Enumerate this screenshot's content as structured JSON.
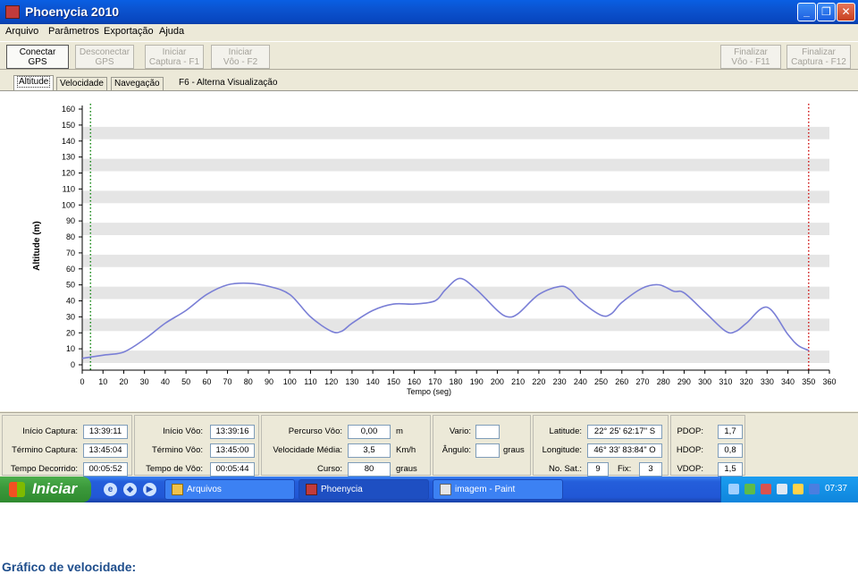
{
  "window": {
    "title": "Phoenycia 2010"
  },
  "menu": [
    "Arquivo",
    "Parâmetros",
    "Exportação",
    "Ajuda"
  ],
  "toolbar": {
    "buttons": [
      {
        "line1": "Conectar",
        "line2": "GPS",
        "enabled": true
      },
      {
        "line1": "Desconectar",
        "line2": "GPS",
        "enabled": false
      },
      {
        "line1": "Iniciar",
        "line2": "Captura - F1",
        "enabled": false
      },
      {
        "line1": "Iniciar",
        "line2": "Vôo - F2",
        "enabled": false
      },
      {
        "line1": "Finalizar",
        "line2": "Vôo - F11",
        "enabled": false
      },
      {
        "line1": "Finalizar",
        "line2": "Captura - F12",
        "enabled": false
      }
    ]
  },
  "tabs": [
    "Altitude",
    "Velocidade",
    "Navegação"
  ],
  "tab_hint": "F6 - Alterna Visualização",
  "chart_data": {
    "type": "line",
    "xlabel": "Tempo (seg)",
    "ylabel": "Altitude (m)",
    "xlim": [
      0,
      360
    ],
    "ylim": [
      0,
      160
    ],
    "xticks": [
      0,
      10,
      20,
      30,
      40,
      50,
      60,
      70,
      80,
      90,
      100,
      110,
      120,
      130,
      140,
      150,
      160,
      170,
      180,
      190,
      200,
      210,
      220,
      230,
      240,
      250,
      260,
      270,
      280,
      290,
      300,
      310,
      320,
      330,
      340,
      350,
      360
    ],
    "yticks": [
      0,
      10,
      20,
      30,
      40,
      50,
      60,
      70,
      80,
      90,
      100,
      110,
      120,
      130,
      140,
      150,
      160
    ],
    "grid": "horizontal bands",
    "markers": [
      {
        "x": 4,
        "color": "#1a8a1a",
        "style": "dotted"
      },
      {
        "x": 350,
        "color": "#d11c1c",
        "style": "dotted"
      }
    ],
    "series": [
      {
        "color": "#7a7fd6",
        "x": [
          0,
          10,
          20,
          30,
          40,
          50,
          60,
          70,
          80,
          90,
          100,
          110,
          120,
          125,
          130,
          140,
          150,
          160,
          170,
          175,
          182,
          190,
          200,
          205,
          210,
          220,
          230,
          235,
          240,
          250,
          255,
          260,
          270,
          278,
          285,
          290,
          300,
          310,
          315,
          320,
          330,
          340,
          345,
          350
        ],
        "y": [
          4,
          6,
          8,
          16,
          26,
          34,
          44,
          50,
          51,
          49,
          44,
          30,
          21,
          21,
          26,
          34,
          38,
          38,
          40,
          47,
          54,
          47,
          34,
          30,
          32,
          44,
          49,
          47,
          40,
          31,
          32,
          39,
          48,
          50,
          46,
          45,
          33,
          21,
          21,
          26,
          36,
          19,
          12,
          9
        ]
      }
    ]
  },
  "status": {
    "captura": [
      {
        "label": "Início Captura:",
        "value": "13:39:11"
      },
      {
        "label": "Término Captura:",
        "value": "13:45:04"
      },
      {
        "label": "Tempo Decorrido:",
        "value": "00:05:52"
      }
    ],
    "voo": [
      {
        "label": "Início Vôo:",
        "value": "13:39:16"
      },
      {
        "label": "Término Vôo:",
        "value": "13:45:00"
      },
      {
        "label": "Tempo de Vôo:",
        "value": "00:05:44"
      }
    ],
    "percurso": [
      {
        "label": "Percurso Vôo:",
        "value": "0,00",
        "unit": "m"
      },
      {
        "label": "Velocidade Média:",
        "value": "3,5",
        "unit": "Km/h"
      },
      {
        "label": "Curso:",
        "value": "80",
        "unit": "graus"
      }
    ],
    "vario": {
      "label": "Vario:",
      "value": ""
    },
    "angulo": {
      "label": "Ângulo:",
      "value": "",
      "unit": "graus"
    },
    "latitude": {
      "label": "Latitude:",
      "value": "22° 25' 62:17\" S"
    },
    "longitude": {
      "label": "Longitude:",
      "value": "46° 33' 83:84\" O"
    },
    "nosat": {
      "label": "No. Sat.:",
      "value": "9"
    },
    "fix": {
      "label": "Fix:",
      "value": "3"
    },
    "dop": [
      {
        "label": "PDOP:",
        "value": "1,7"
      },
      {
        "label": "HDOP:",
        "value": "0,8"
      },
      {
        "label": "VDOP:",
        "value": "1,5"
      }
    ]
  },
  "taskbar": {
    "start": "Iniciar",
    "tasks": [
      "Arquivos",
      "Phoenycia",
      "imagem - Paint"
    ],
    "clock": "07:37"
  },
  "caption": "Gráfico de velocidade:"
}
